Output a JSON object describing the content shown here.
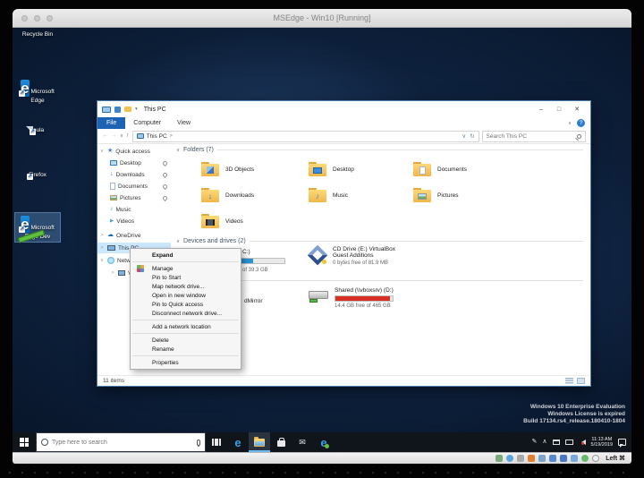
{
  "vm": {
    "title": "MSEdge - Win10 [Running]",
    "host_key_label": "Left ⌘"
  },
  "desktop": {
    "icons": [
      {
        "label": "Recycle Bin"
      },
      {
        "label": "Microsoft Edge"
      },
      {
        "label": "eula"
      },
      {
        "label": "Firefox"
      },
      {
        "label": "Microsoft Edge Dev"
      }
    ],
    "watermark": [
      "Windows 10 Enterprise Evaluation",
      "Windows License is expired",
      "Build 17134.rs4_release.180410-1804"
    ]
  },
  "explorer": {
    "title": "This PC",
    "tabs": {
      "file": "File",
      "computer": "Computer",
      "view": "View"
    },
    "address": {
      "breadcrumb": "This PC",
      "breadcrumb_sep": ">",
      "search_placeholder": "Search This PC"
    },
    "nav": {
      "quick_access": "Quick access",
      "desktop": "Desktop",
      "downloads": "Downloads",
      "documents": "Documents",
      "pictures": "Pictures",
      "music": "Music",
      "videos": "Videos",
      "onedrive": "OneDrive",
      "this_pc": "This PC",
      "network": "Network",
      "vbox_fragment": "VB"
    },
    "folders_header": "Folders (7)",
    "folders": [
      "3D Objects",
      "Desktop",
      "Documents",
      "Downloads",
      "Music",
      "Pictures",
      "Videos"
    ],
    "devices_header": "Devices and drives (2)",
    "local_disk": {
      "label_fragment": "C:)",
      "detail_fragment": "of 39.3 GB",
      "fill_style": "width:45%"
    },
    "cd_drive": {
      "line1": "CD Drive (E:) VirtualBox",
      "line2": "Guest Additions",
      "detail": "0 bytes free of 81.9 MB"
    },
    "network_item_fragment": "dMirror",
    "shared_drive": {
      "label": "Shared (\\\\vboxsrv) (D:)",
      "detail": "14.4 GB free of 465 GB",
      "fill_style": "width:96%"
    },
    "status": "11 items"
  },
  "context_menu": {
    "items": [
      "Expand",
      "Manage",
      "Pin to Start",
      "Map network drive...",
      "Open in new window",
      "Pin to Quick access",
      "Disconnect network drive...",
      "Add a network location",
      "Delete",
      "Rename",
      "Properties"
    ]
  },
  "taskbar": {
    "search_placeholder": "Type here to search",
    "time": "11:13 AM",
    "date": "5/19/2019"
  },
  "glyphs": {
    "chev_down": "∨",
    "chev_right": ">",
    "back": "←",
    "forward": "→",
    "up": "↑",
    "refresh": "↻",
    "dropdown": "∨",
    "minimize": "–",
    "maximize": "□",
    "close": "✕",
    "help": "?",
    "edge_letter": "e",
    "cloud": "☁",
    "star": "★",
    "note": "♪",
    "play": "▶",
    "down_arrow": "↓",
    "mail": "✉",
    "pen": "✎",
    "chev_up": "∧",
    "shortcut_arrow": "↗",
    "qat_dropdown": "▾"
  }
}
